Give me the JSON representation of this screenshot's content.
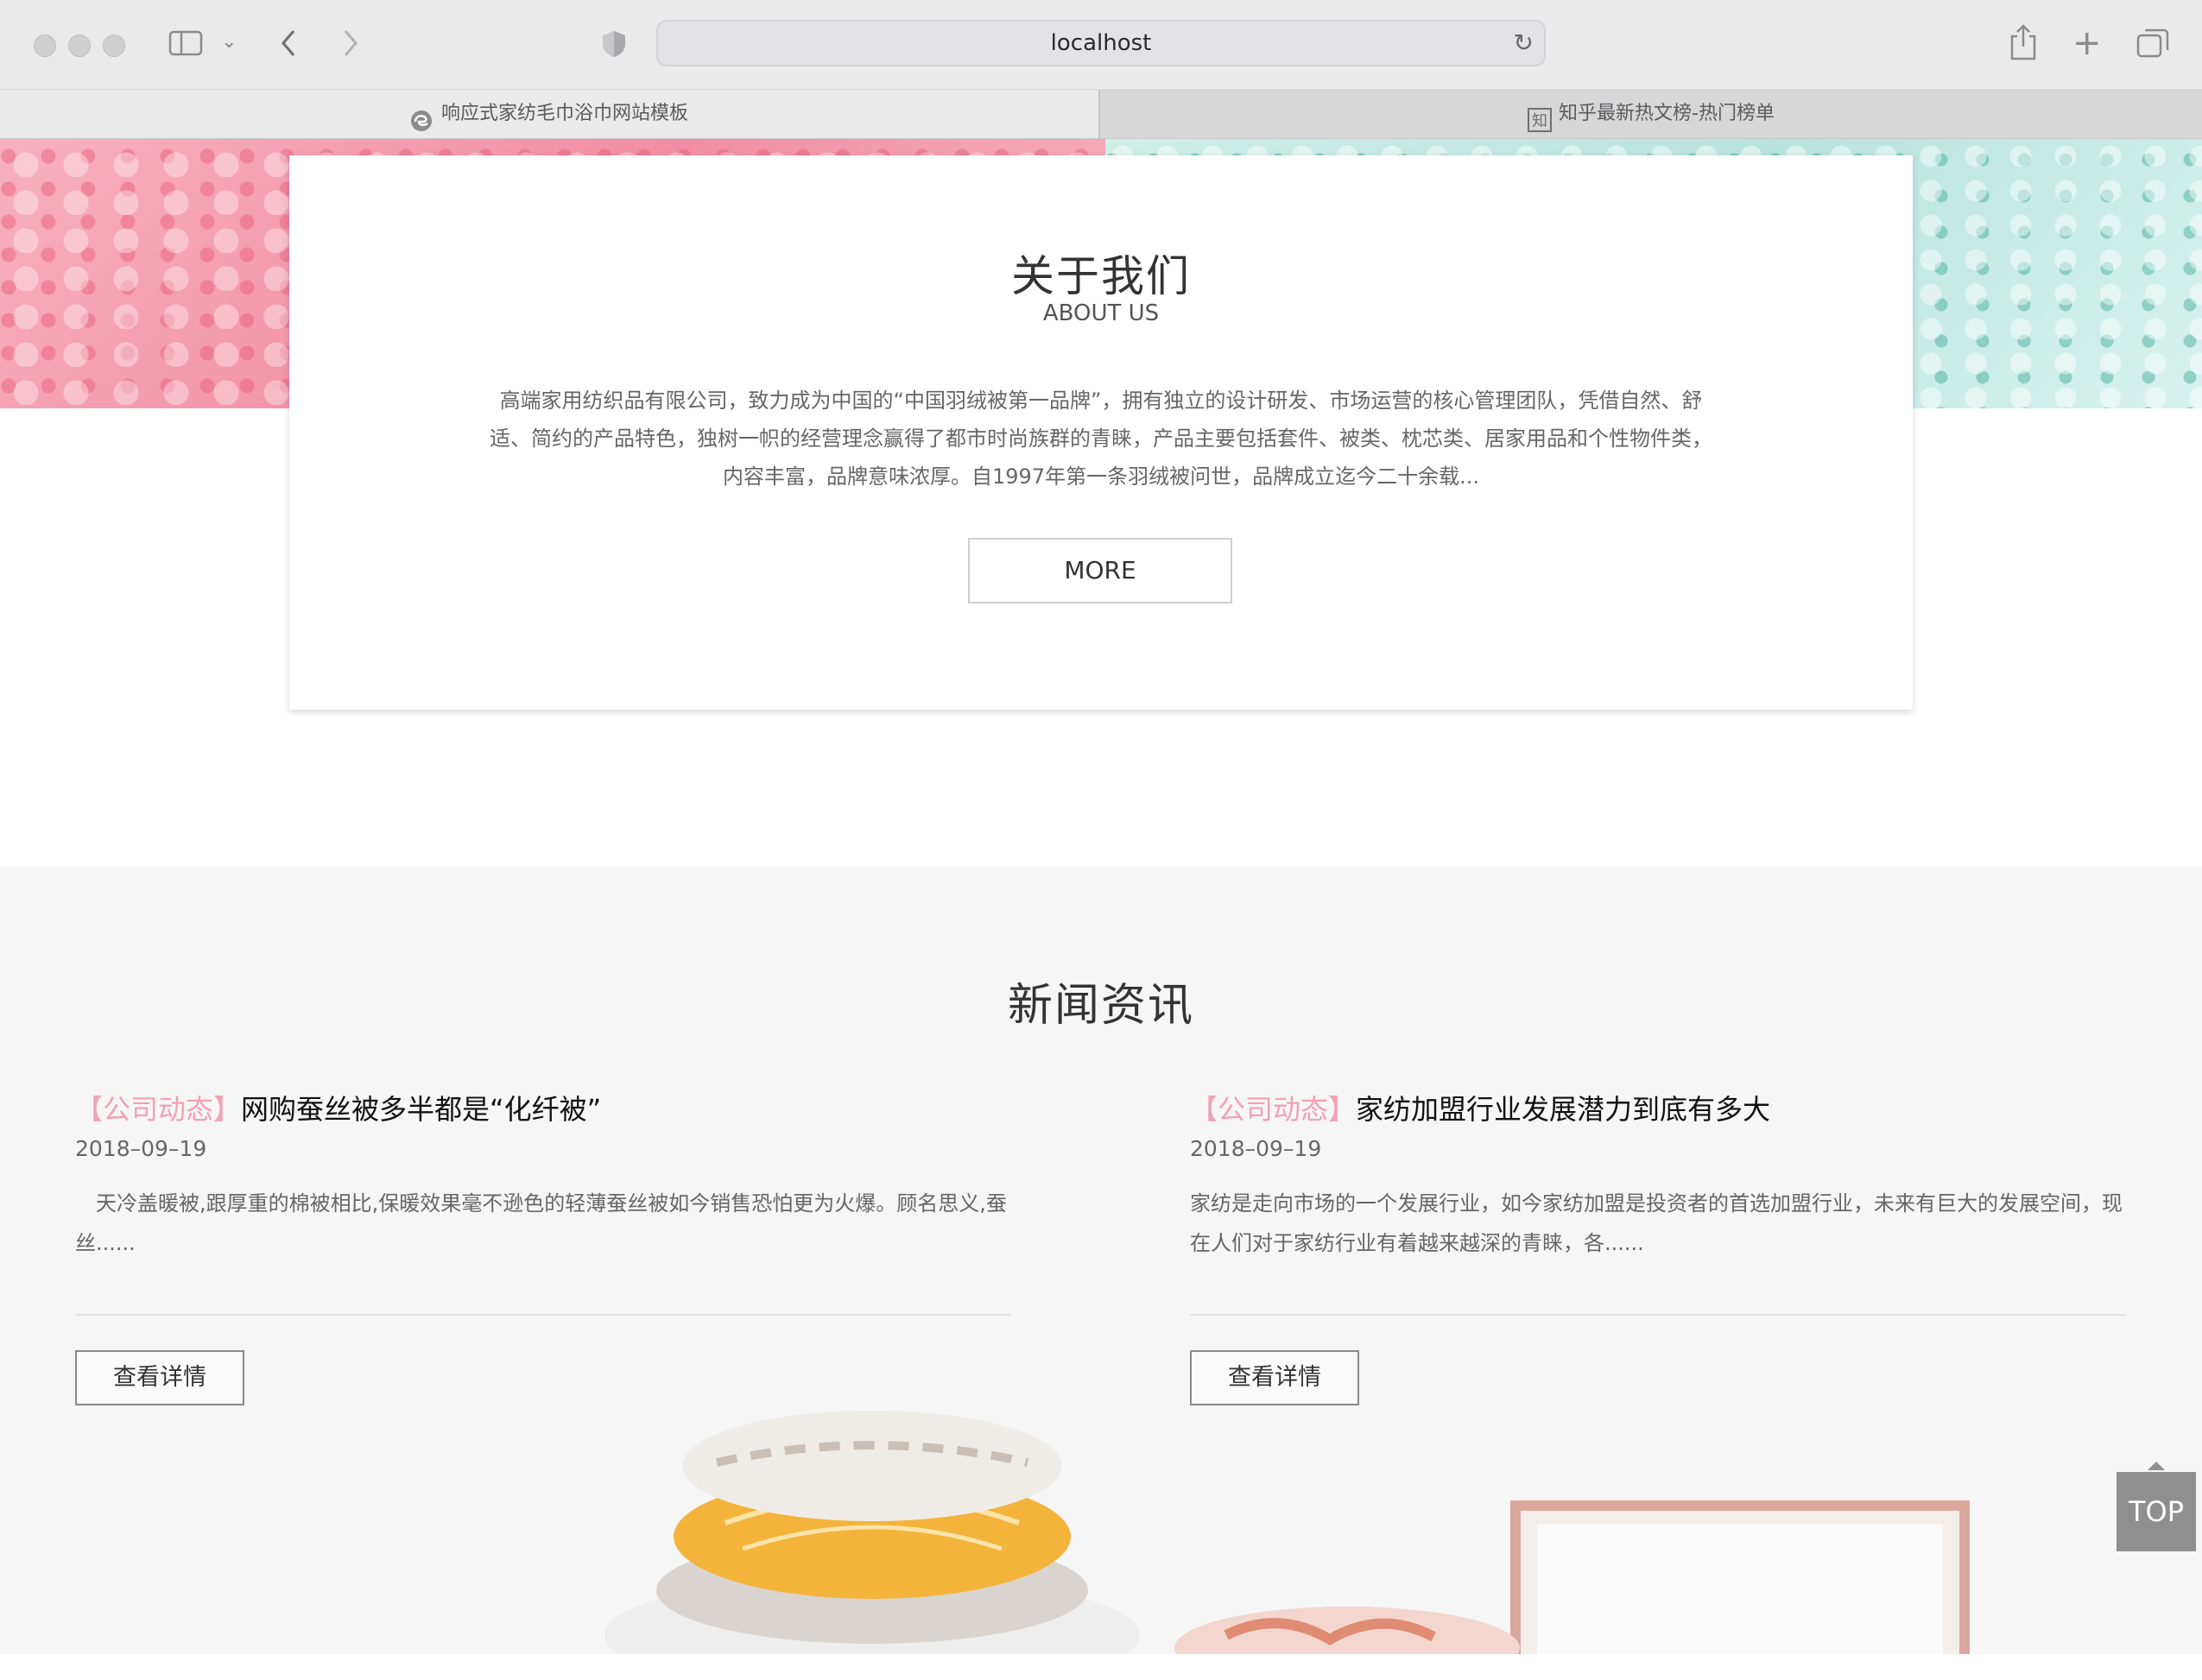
{
  "browser": {
    "url": "localhost",
    "tabs": [
      {
        "label": "响应式家纺毛巾浴巾网站模板",
        "icon": "edge-favicon-icon",
        "active": true
      },
      {
        "label": "知乎最新热文榜-热门榜单",
        "icon": "zhihu-favicon-icon",
        "active": false
      }
    ]
  },
  "about": {
    "title": "关于我们",
    "subtitle": "ABOUT US",
    "text": "高端家用纺织品有限公司，致力成为中国的“中国羽绒被第一品牌”，拥有独立的设计研发、市场运营的核心管理团队，凭借自然、舒适、简约的产品特色，独树一帜的经营理念赢得了都市时尚族群的青睐，产品主要包括套件、被类、枕芯类、居家用品和个性物件类，内容丰富，品牌意味浓厚。自1997年第一条羽绒被问世，品牌成立迄今二十余载...",
    "more_label": "MORE"
  },
  "news": {
    "title": "新闻资讯",
    "items": [
      {
        "tag": "【公司动态】",
        "headline": "网购蚕丝被多半都是“化纤被”",
        "date": "2018–09–19",
        "summary": "　天冷盖暖被,跟厚重的棉被相比,保暖效果毫不逊色的轻薄蚕丝被如今销售恐怕更为火爆。顾名思义,蚕丝......",
        "button": "查看详情"
      },
      {
        "tag": "【公司动态】",
        "headline": "家纺加盟行业发展潜力到底有多大",
        "date": "2018–09–19",
        "summary": "家纺是走向市场的一个发展行业，如今家纺加盟是投资者的首选加盟行业，未来有巨大的发展空间，现在人们对于家纺行业有着越来越深的青睐，各......",
        "button": "查看详情"
      }
    ]
  },
  "back_to_top": "TOP",
  "colors": {
    "tag_pink": "#f3a1b4",
    "top_button": "#8f8f8f"
  }
}
